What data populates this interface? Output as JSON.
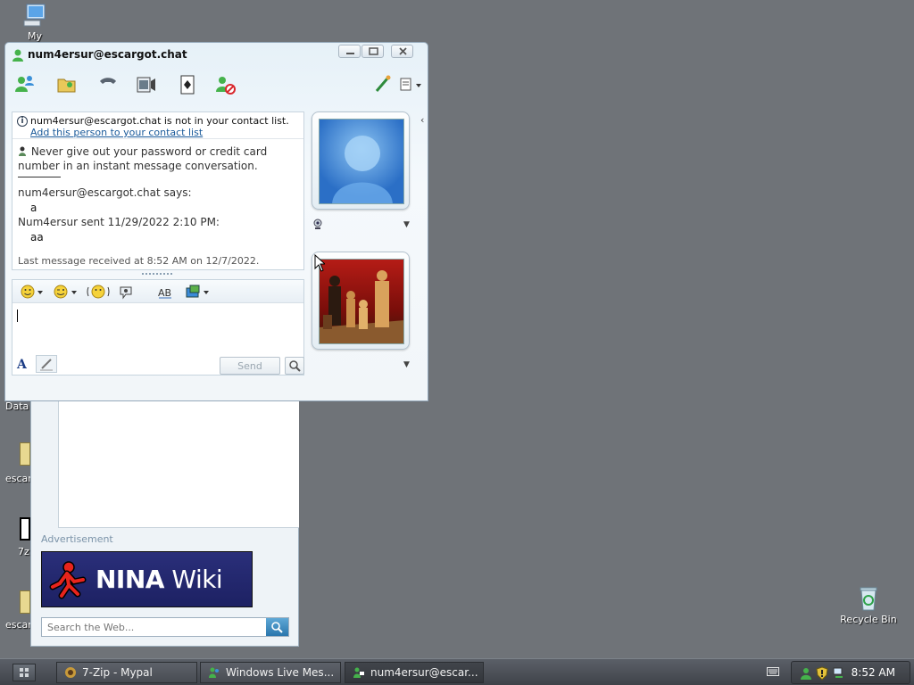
{
  "desktop": {
    "icons": {
      "my_computer": "My",
      "recycle_bin": "Recycle Bin"
    },
    "partial_labels": [
      "Data",
      "escar",
      "7z",
      "escar"
    ]
  },
  "main_window": {
    "ad_label": "Advertisement",
    "ad_banner_text_bold": "NINA",
    "ad_banner_text": " Wiki",
    "search_placeholder": "Search the Web..."
  },
  "conversation": {
    "title": "num4ersur@escargot.chat",
    "info_bar": {
      "text": "num4ersur@escargot.chat is not in your contact list.",
      "link": "Add this person to your contact list"
    },
    "warning": "Never give out your password or credit card number in an instant message conversation.",
    "messages": [
      {
        "header": "num4ersur@escargot.chat says:",
        "text": "a"
      },
      {
        "header": "Num4ersur sent 11/29/2022 2:10 PM:",
        "text": "aa"
      }
    ],
    "last_message": "Last message received at 8:52 AM on 12/7/2022.",
    "send_label": "Send",
    "compose_value": ""
  },
  "taskbar": {
    "tasks": [
      {
        "label": "7-Zip - Mypal",
        "active": false
      },
      {
        "label": "Windows Live Mes...",
        "active": false
      },
      {
        "label": "num4ersur@escar...",
        "active": true
      }
    ],
    "clock": "8:52 AM"
  }
}
